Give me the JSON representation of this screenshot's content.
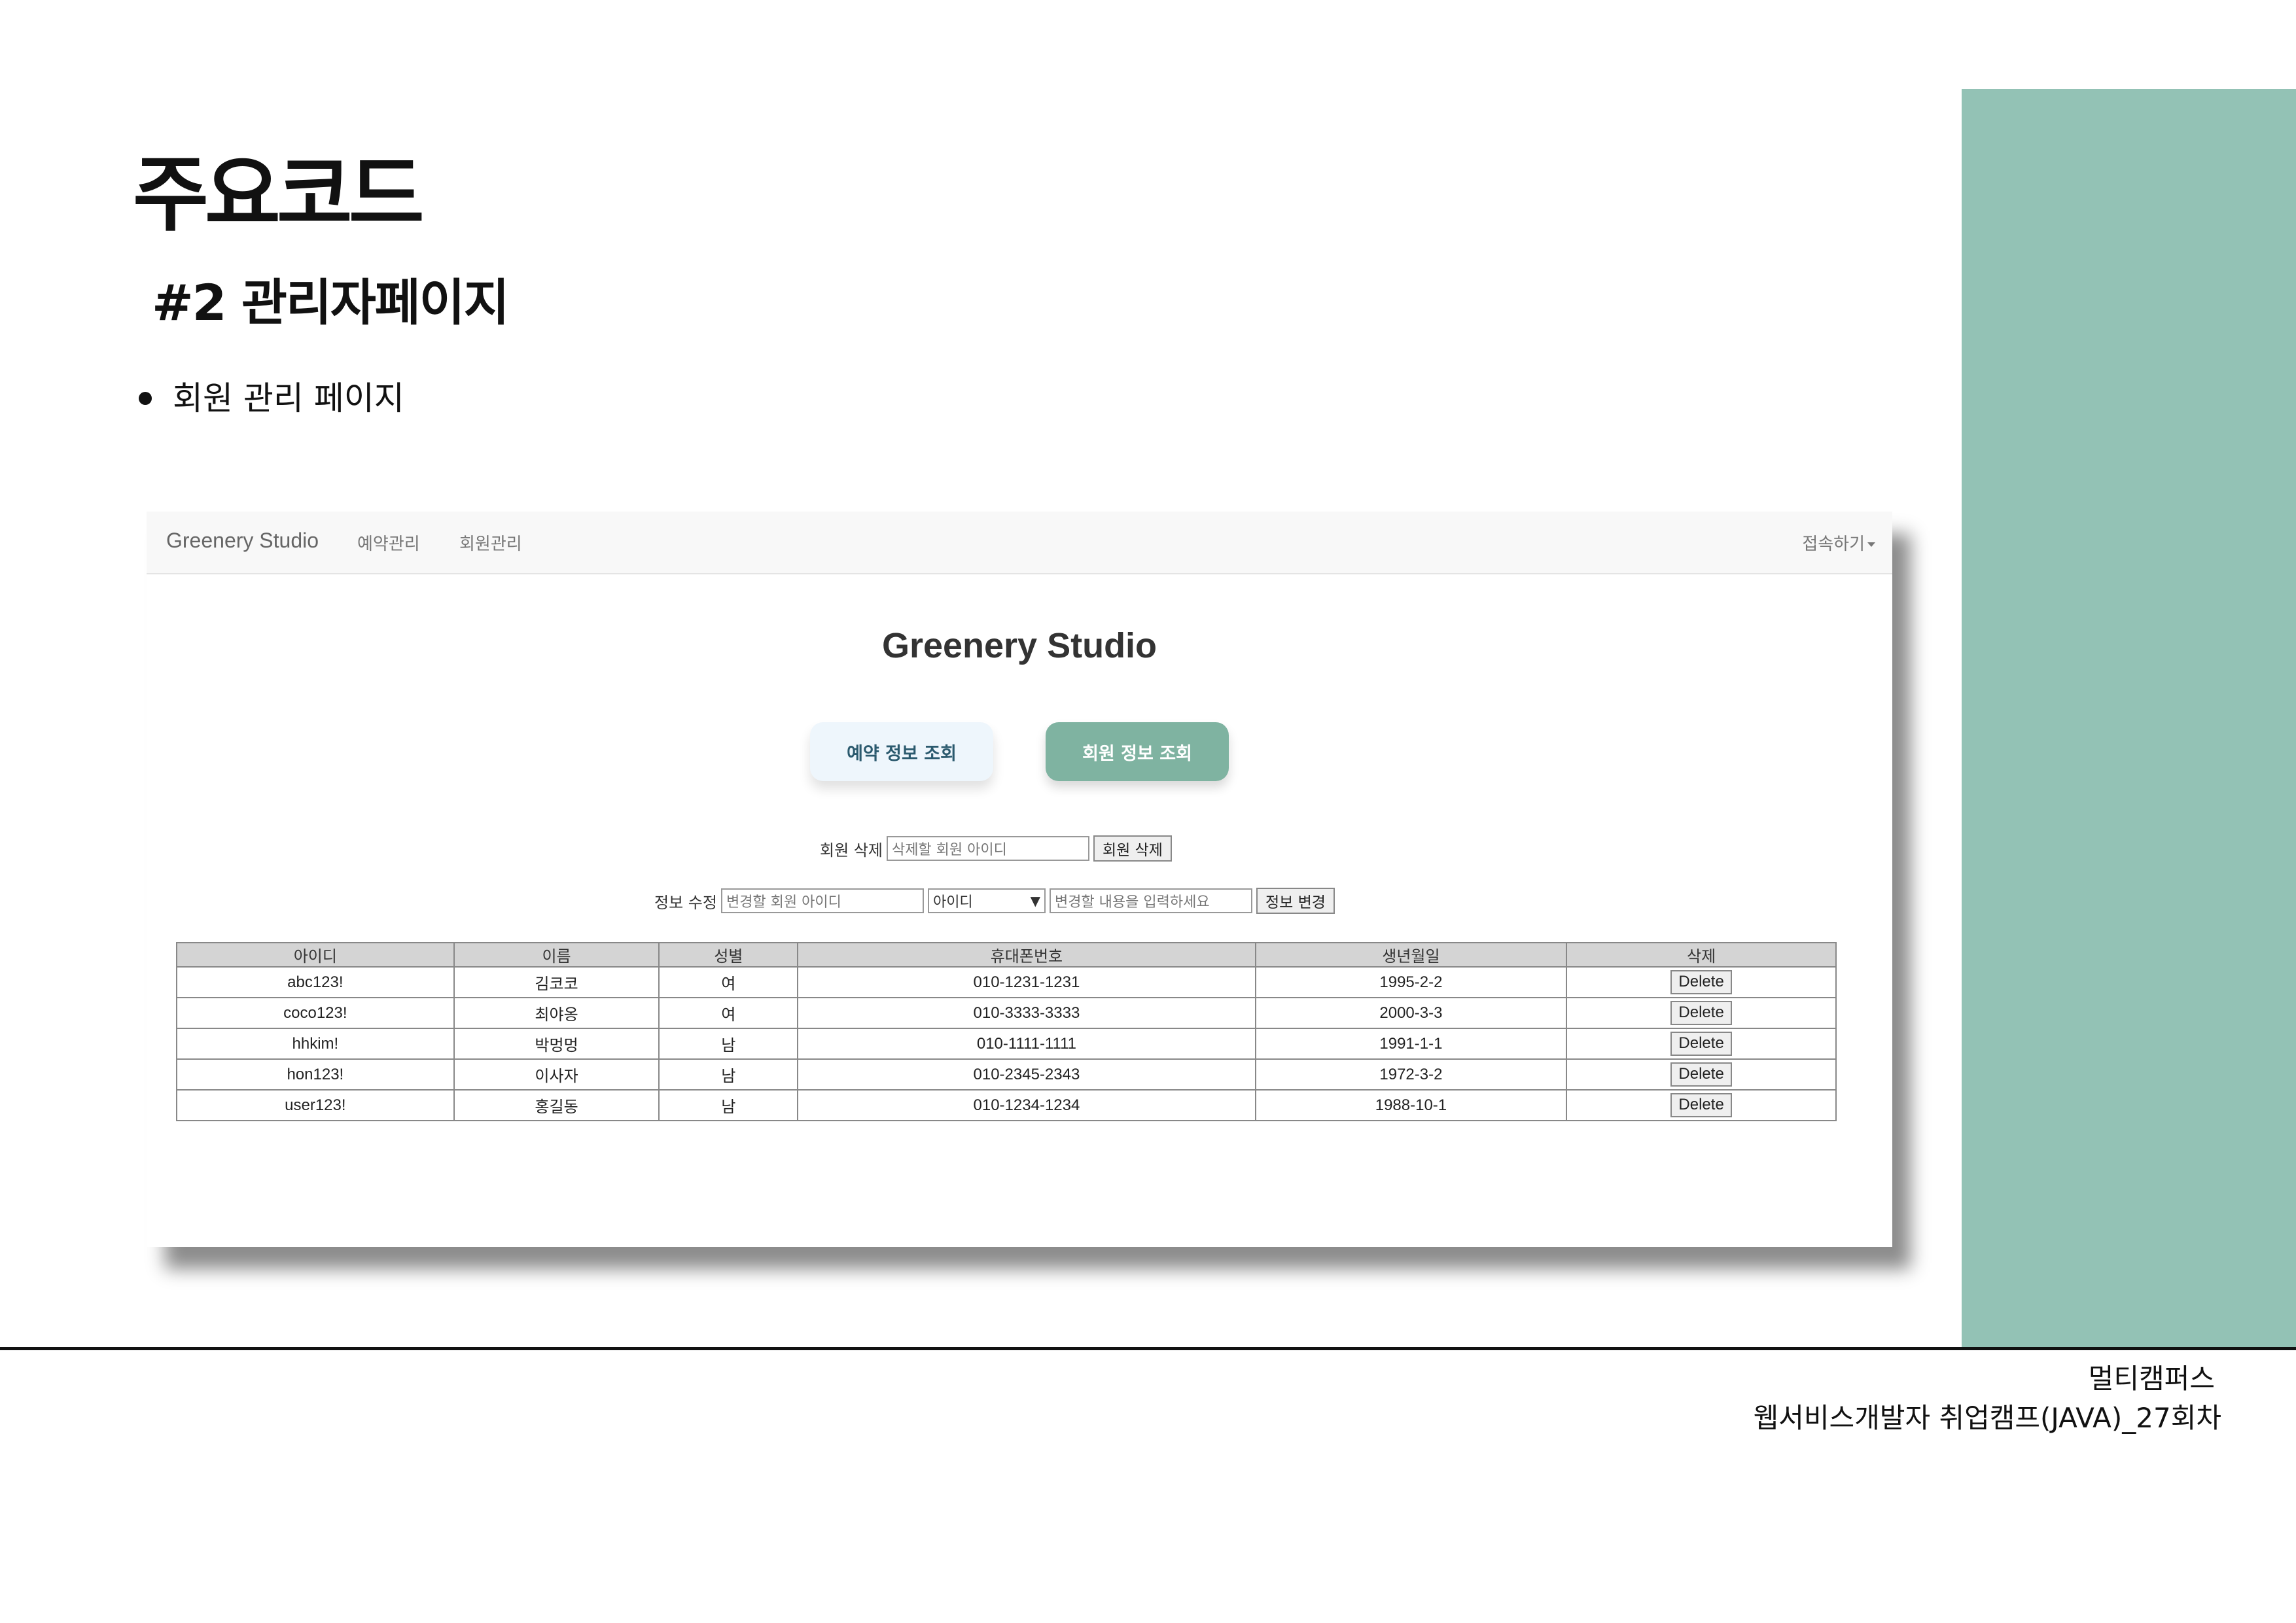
{
  "slide": {
    "title": "주요코드",
    "subtitle": "#2 관리자페이지",
    "bullet": "회원 관리 페이지",
    "footer_org": "멀티캠퍼스",
    "footer_course": "웹서비스개발자 취업캠프(JAVA)_27회차"
  },
  "colors": {
    "side_panel": "#93c2b5",
    "member_button": "#7fb3a1",
    "reservation_button": "#eef6fc"
  },
  "app": {
    "navbar": {
      "brand": "Greenery Studio",
      "links": [
        "예약관리",
        "회원관리"
      ],
      "account": "접속하기"
    },
    "heading": "Greenery Studio",
    "buttons": {
      "reservation": "예약 정보 조회",
      "member": "회원 정보 조회"
    },
    "delete_form": {
      "label": "회원 삭제",
      "placeholder": "삭제할 회원 아이디",
      "button": "회원 삭제"
    },
    "edit_form": {
      "label": "정보 수정",
      "id_placeholder": "변경할 회원 아이디",
      "field_selected": "아이디",
      "value_placeholder": "변경할 내용을 입력하세요",
      "button": "정보 변경"
    },
    "table": {
      "headers": [
        "아이디",
        "이름",
        "성별",
        "휴대폰번호",
        "생년월일",
        "삭제"
      ],
      "rows": [
        [
          "abc123!",
          "김코코",
          "여",
          "010-1231-1231",
          "1995-2-2",
          "Delete"
        ],
        [
          "coco123!",
          "최야옹",
          "여",
          "010-3333-3333",
          "2000-3-3",
          "Delete"
        ],
        [
          "hhkim!",
          "박멍멍",
          "남",
          "010-1111-1111",
          "1991-1-1",
          "Delete"
        ],
        [
          "hon123!",
          "이사자",
          "남",
          "010-2345-2343",
          "1972-3-2",
          "Delete"
        ],
        [
          "user123!",
          "홍길동",
          "남",
          "010-1234-1234",
          "1988-10-1",
          "Delete"
        ]
      ]
    }
  }
}
